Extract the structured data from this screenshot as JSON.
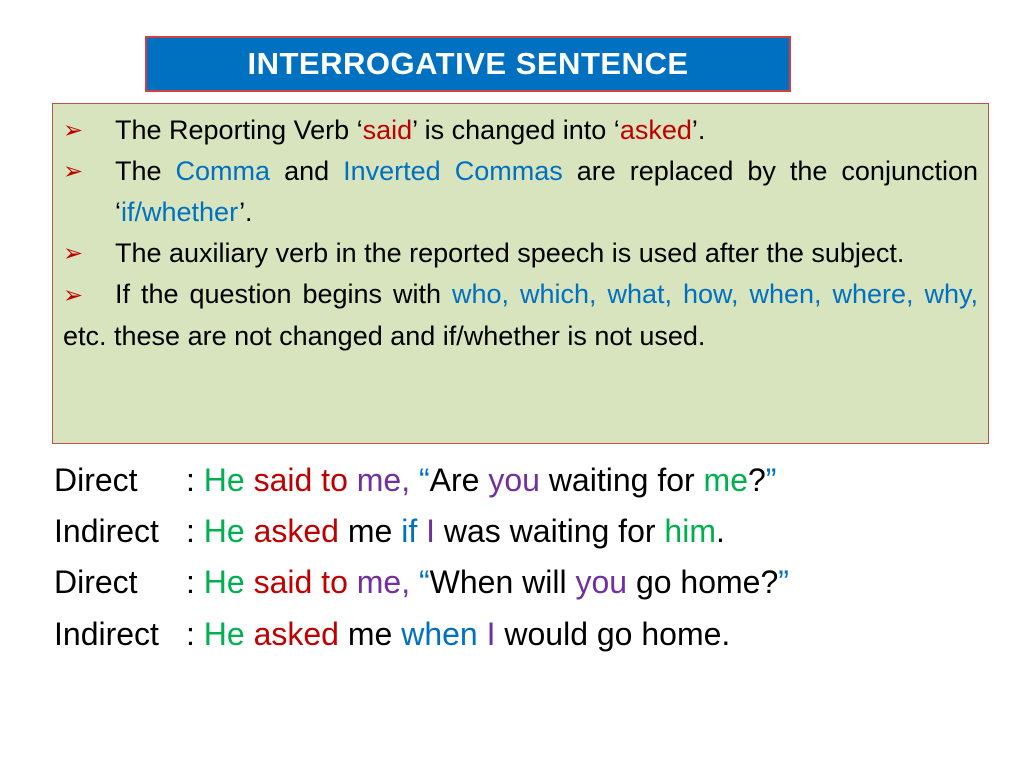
{
  "title": "INTERROGATIVE SENTENCE",
  "rules": {
    "r1": {
      "a": "The Reporting Verb ‘",
      "b": "said",
      "c": "’ is changed into ‘",
      "d": "asked",
      "e": "’."
    },
    "r2": {
      "a": "The ",
      "b": "Comma",
      "c": " and ",
      "d": "Inverted Commas",
      "e": " are replaced by the conjunction ‘",
      "f": "if/whether",
      "g": "’."
    },
    "r3": {
      "a": "The auxiliary verb in the reported speech is used after the subject."
    },
    "r4": {
      "a": "If the question begins with ",
      "b": "who, which, what, how, when,",
      "c": "where, why,",
      "d": " etc. these are not changed and if/whether is not used."
    }
  },
  "examples": [
    {
      "label": "Direct",
      "sep": ": ",
      "w": [
        "He",
        " said to",
        " me,",
        " “",
        "Are ",
        "you",
        " waiting for ",
        "me",
        "?",
        "”"
      ]
    },
    {
      "label": "Indirect",
      "sep": ": ",
      "w": [
        "He",
        " asked",
        " me ",
        "if",
        " I",
        " was waiting for ",
        "him",
        "."
      ]
    },
    {
      "label": "Direct",
      "sep": ": ",
      "w": [
        "He",
        " said to",
        " me,",
        " “",
        "When will ",
        "you",
        " go home?",
        "”"
      ]
    },
    {
      "label": "Indirect",
      "sep": ": ",
      "w": [
        "He",
        " asked",
        " me ",
        "when",
        " I",
        " would go home."
      ]
    }
  ]
}
